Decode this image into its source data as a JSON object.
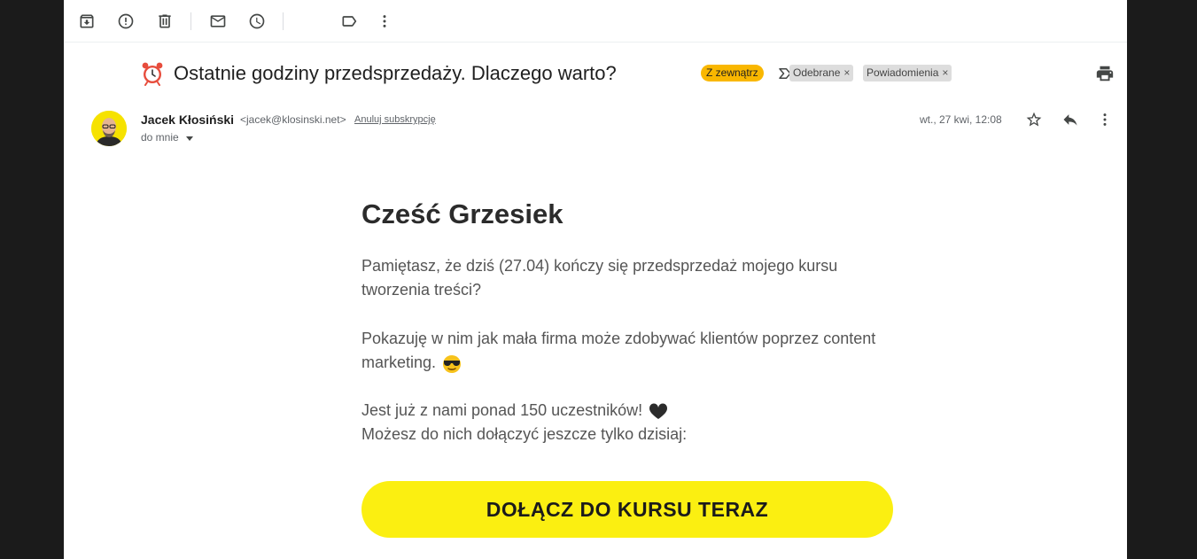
{
  "toolbar": {
    "icons": [
      "archive-icon",
      "spam-icon",
      "delete-icon",
      "mark-unread-icon",
      "snooze-icon",
      "label-icon",
      "more-icon"
    ]
  },
  "email": {
    "subject": "Ostatnie godziny przedsprzedaży. Dlaczego warto?",
    "external_badge": "Z zewnątrz",
    "labels": [
      "Odebrane",
      "Powiadomienia"
    ],
    "sender_name": "Jacek Kłosiński",
    "sender_email": "<jacek@klosinski.net>",
    "unsubscribe": "Anuluj subskrypcję",
    "recipient": "do mnie",
    "date": "wt., 27 kwi, 12:08"
  },
  "body": {
    "greeting": "Cześć Grzesiek",
    "p1": "Pamiętasz, że dziś (27.04) kończy się przedsprzedaż mojego kursu tworzenia treści?",
    "p2": "Pokazuję w nim jak mała firma może zdobywać klientów poprzez content marketing.",
    "p3_line1": "Jest już z nami ponad 150 uczestników!",
    "p3_line2": "Możesz do nich dołączyć jeszcze tylko dzisiaj:",
    "cta": "DOŁĄCZ DO KURSU TERAZ"
  },
  "colors": {
    "external_badge_bg": "#f9b700",
    "cta_bg": "#fbef11",
    "avatar_bg": "#f6e200"
  }
}
